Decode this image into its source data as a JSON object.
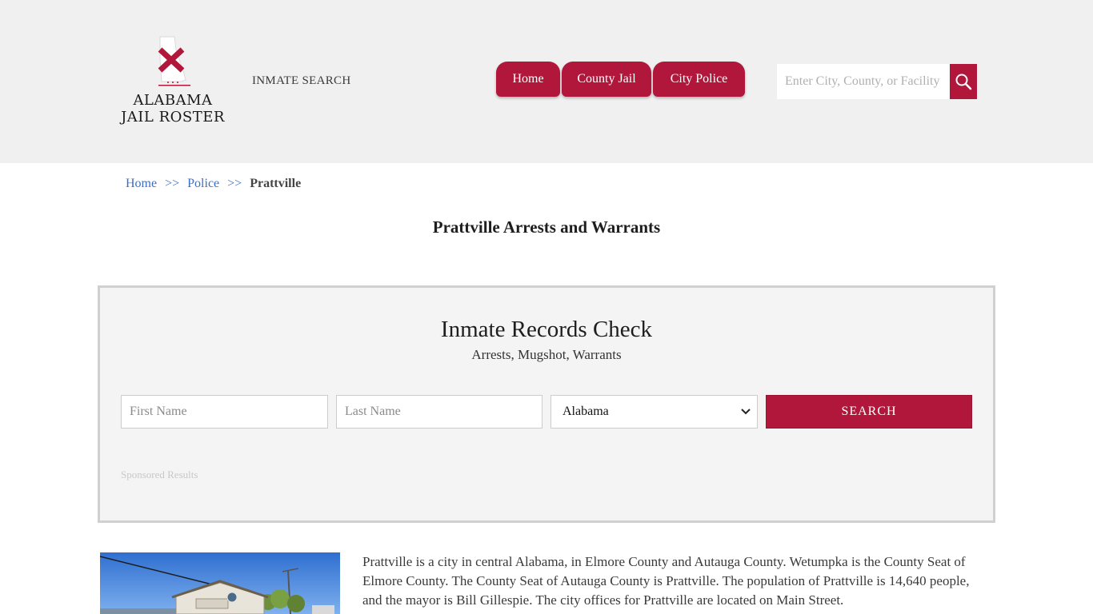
{
  "header": {
    "logo": {
      "line1": "ALABAMA",
      "line2": "JAIL ROSTER"
    },
    "inmate_search_link": "INMATE SEARCH",
    "nav": [
      {
        "label": "Home"
      },
      {
        "label": "County Jail"
      },
      {
        "label": "City Police"
      }
    ],
    "search": {
      "placeholder": "Enter City, County, or Facility",
      "value": ""
    }
  },
  "breadcrumb": {
    "items": [
      "Home",
      "Police"
    ],
    "separator": ">>",
    "current": "Prattville"
  },
  "page_title": "Prattville Arrests and Warrants",
  "records": {
    "title": "Inmate Records Check",
    "subtitle": "Arrests, Mugshot, Warrants",
    "first_name_placeholder": "First Name",
    "last_name_placeholder": "Last Name",
    "state_selected": "Alabama",
    "search_label": "SEARCH",
    "sponsored": "Sponsored Results"
  },
  "description": "Prattville is a city in central Alabama, in Elmore County and Autauga County. Wetumpka is the County Seat of Elmore County. The County Seat of Autauga County is Prattville. The population of Prattville is 14,640 people, and the mayor is Bill Gillespie. The city offices for Prattville are located on Main Street.",
  "colors": {
    "accent": "#b1173b",
    "header_bg": "#f0f0f0",
    "link": "#3b6fc4"
  }
}
